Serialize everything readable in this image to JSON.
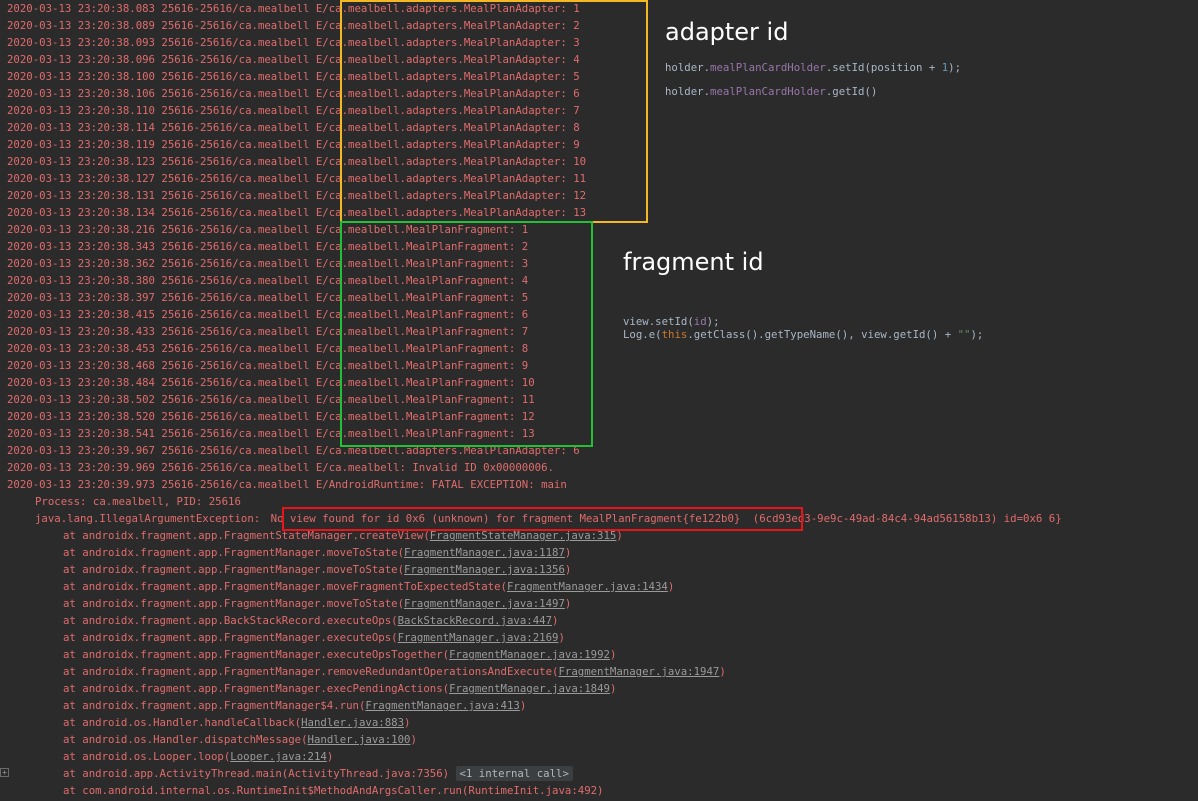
{
  "log_lines": [
    {
      "prefix": "2020-03-13 23:20:38.083 25616-25616/ca.mealbell ",
      "message": "E/ca.mealbell.adapters.MealPlanAdapter: 1"
    },
    {
      "prefix": "2020-03-13 23:20:38.089 25616-25616/ca.mealbell ",
      "message": "E/ca.mealbell.adapters.MealPlanAdapter: 2"
    },
    {
      "prefix": "2020-03-13 23:20:38.093 25616-25616/ca.mealbell ",
      "message": "E/ca.mealbell.adapters.MealPlanAdapter: 3"
    },
    {
      "prefix": "2020-03-13 23:20:38.096 25616-25616/ca.mealbell ",
      "message": "E/ca.mealbell.adapters.MealPlanAdapter: 4"
    },
    {
      "prefix": "2020-03-13 23:20:38.100 25616-25616/ca.mealbell ",
      "message": "E/ca.mealbell.adapters.MealPlanAdapter: 5"
    },
    {
      "prefix": "2020-03-13 23:20:38.106 25616-25616/ca.mealbell ",
      "message": "E/ca.mealbell.adapters.MealPlanAdapter: 6"
    },
    {
      "prefix": "2020-03-13 23:20:38.110 25616-25616/ca.mealbell ",
      "message": "E/ca.mealbell.adapters.MealPlanAdapter: 7"
    },
    {
      "prefix": "2020-03-13 23:20:38.114 25616-25616/ca.mealbell ",
      "message": "E/ca.mealbell.adapters.MealPlanAdapter: 8"
    },
    {
      "prefix": "2020-03-13 23:20:38.119 25616-25616/ca.mealbell ",
      "message": "E/ca.mealbell.adapters.MealPlanAdapter: 9"
    },
    {
      "prefix": "2020-03-13 23:20:38.123 25616-25616/ca.mealbell ",
      "message": "E/ca.mealbell.adapters.MealPlanAdapter: 10"
    },
    {
      "prefix": "2020-03-13 23:20:38.127 25616-25616/ca.mealbell ",
      "message": "E/ca.mealbell.adapters.MealPlanAdapter: 11"
    },
    {
      "prefix": "2020-03-13 23:20:38.131 25616-25616/ca.mealbell ",
      "message": "E/ca.mealbell.adapters.MealPlanAdapter: 12"
    },
    {
      "prefix": "2020-03-13 23:20:38.134 25616-25616/ca.mealbell ",
      "message": "E/ca.mealbell.adapters.MealPlanAdapter: 13"
    },
    {
      "prefix": "2020-03-13 23:20:38.216 25616-25616/ca.mealbell ",
      "message": "E/ca.mealbell.MealPlanFragment: 1"
    },
    {
      "prefix": "2020-03-13 23:20:38.343 25616-25616/ca.mealbell ",
      "message": "E/ca.mealbell.MealPlanFragment: 2"
    },
    {
      "prefix": "2020-03-13 23:20:38.362 25616-25616/ca.mealbell ",
      "message": "E/ca.mealbell.MealPlanFragment: 3"
    },
    {
      "prefix": "2020-03-13 23:20:38.380 25616-25616/ca.mealbell ",
      "message": "E/ca.mealbell.MealPlanFragment: 4"
    },
    {
      "prefix": "2020-03-13 23:20:38.397 25616-25616/ca.mealbell ",
      "message": "E/ca.mealbell.MealPlanFragment: 5"
    },
    {
      "prefix": "2020-03-13 23:20:38.415 25616-25616/ca.mealbell ",
      "message": "E/ca.mealbell.MealPlanFragment: 6"
    },
    {
      "prefix": "2020-03-13 23:20:38.433 25616-25616/ca.mealbell ",
      "message": "E/ca.mealbell.MealPlanFragment: 7"
    },
    {
      "prefix": "2020-03-13 23:20:38.453 25616-25616/ca.mealbell ",
      "message": "E/ca.mealbell.MealPlanFragment: 8"
    },
    {
      "prefix": "2020-03-13 23:20:38.468 25616-25616/ca.mealbell ",
      "message": "E/ca.mealbell.MealPlanFragment: 9"
    },
    {
      "prefix": "2020-03-13 23:20:38.484 25616-25616/ca.mealbell ",
      "message": "E/ca.mealbell.MealPlanFragment: 10"
    },
    {
      "prefix": "2020-03-13 23:20:38.502 25616-25616/ca.mealbell ",
      "message": "E/ca.mealbell.MealPlanFragment: 11"
    },
    {
      "prefix": "2020-03-13 23:20:38.520 25616-25616/ca.mealbell ",
      "message": "E/ca.mealbell.MealPlanFragment: 12"
    },
    {
      "prefix": "2020-03-13 23:20:38.541 25616-25616/ca.mealbell ",
      "message": "E/ca.mealbell.MealPlanFragment: 13"
    },
    {
      "prefix": "2020-03-13 23:20:39.967 25616-25616/ca.mealbell ",
      "message": "E/ca.mealbell.adapters.MealPlanAdapter: 6"
    },
    {
      "prefix": "2020-03-13 23:20:39.969 25616-25616/ca.mealbell ",
      "message": "E/ca.mealbell: Invalid ID 0x00000006."
    },
    {
      "prefix": "2020-03-13 23:20:39.973 25616-25616/ca.mealbell ",
      "message": "E/AndroidRuntime: FATAL EXCEPTION: main"
    }
  ],
  "process_line": "Process: ca.mealbell, PID: 25616",
  "exception": {
    "prefix": "java.lang.IllegalArgumentException: ",
    "highlight": "No view found for id 0x6 (unknown) for fragment MealPlanFragment{fe122b0}",
    "suffix": " (6cd93ed3-9e9c-49ad-84c4-94ad56158b13) id=0x6 6}"
  },
  "stack": [
    {
      "method": "at androidx.fragment.app.FragmentStateManager.createView(",
      "file": "FragmentStateManager.java:315",
      "end": ")"
    },
    {
      "method": "at androidx.fragment.app.FragmentManager.moveToState(",
      "file": "FragmentManager.java:1187",
      "end": ")"
    },
    {
      "method": "at androidx.fragment.app.FragmentManager.moveToState(",
      "file": "FragmentManager.java:1356",
      "end": ")"
    },
    {
      "method": "at androidx.fragment.app.FragmentManager.moveFragmentToExpectedState(",
      "file": "FragmentManager.java:1434",
      "end": ")"
    },
    {
      "method": "at androidx.fragment.app.FragmentManager.moveToState(",
      "file": "FragmentManager.java:1497",
      "end": ")"
    },
    {
      "method": "at androidx.fragment.app.BackStackRecord.executeOps(",
      "file": "BackStackRecord.java:447",
      "end": ")"
    },
    {
      "method": "at androidx.fragment.app.FragmentManager.executeOps(",
      "file": "FragmentManager.java:2169",
      "end": ")"
    },
    {
      "method": "at androidx.fragment.app.FragmentManager.executeOpsTogether(",
      "file": "FragmentManager.java:1992",
      "end": ")"
    },
    {
      "method": "at androidx.fragment.app.FragmentManager.removeRedundantOperationsAndExecute(",
      "file": "FragmentManager.java:1947",
      "end": ")"
    },
    {
      "method": "at androidx.fragment.app.FragmentManager.execPendingActions(",
      "file": "FragmentManager.java:1849",
      "end": ")"
    },
    {
      "method": "at androidx.fragment.app.FragmentManager$4.run(",
      "file": "FragmentManager.java:413",
      "end": ")"
    },
    {
      "method": "at android.os.Handler.handleCallback(",
      "file": "Handler.java:883",
      "end": ")"
    },
    {
      "method": "at android.os.Handler.dispatchMessage(",
      "file": "Handler.java:100",
      "end": ")"
    },
    {
      "method": "at android.os.Looper.loop(",
      "file": "Looper.java:214",
      "end": ")"
    }
  ],
  "stack_activity": {
    "text": "at android.app.ActivityThread.main(ActivityThread.java:7356) ",
    "chip": "<1 internal call>"
  },
  "stack_last": "at com.android.internal.os.RuntimeInit$MethodAndArgsCaller.run(RuntimeInit.java:492)",
  "annotations": {
    "adapter_title": "adapter id",
    "adapter_code_1": {
      "a": "holder.",
      "b": "mealPlanCardHolder",
      "c": ".setId(position + ",
      "d": "1",
      "e": ");"
    },
    "adapter_code_2": {
      "a": "holder.",
      "b": "mealPlanCardHolder",
      "c": ".getId()"
    },
    "fragment_title": "fragment id",
    "fragment_code_1": {
      "a": "view.setId(",
      "b": "id",
      "c": ");"
    },
    "fragment_code_2": {
      "a": "Log.e(",
      "b": "this",
      "c": ".getClass().getTypeName(), view.getId() + ",
      "d": "\"\"",
      "e": ");"
    }
  },
  "colors": {
    "background": "#2b2b2b",
    "log_text": "#e06c6c",
    "adapter_box": "#f5b822",
    "fragment_box": "#22c035",
    "error_box": "#e8141a"
  }
}
